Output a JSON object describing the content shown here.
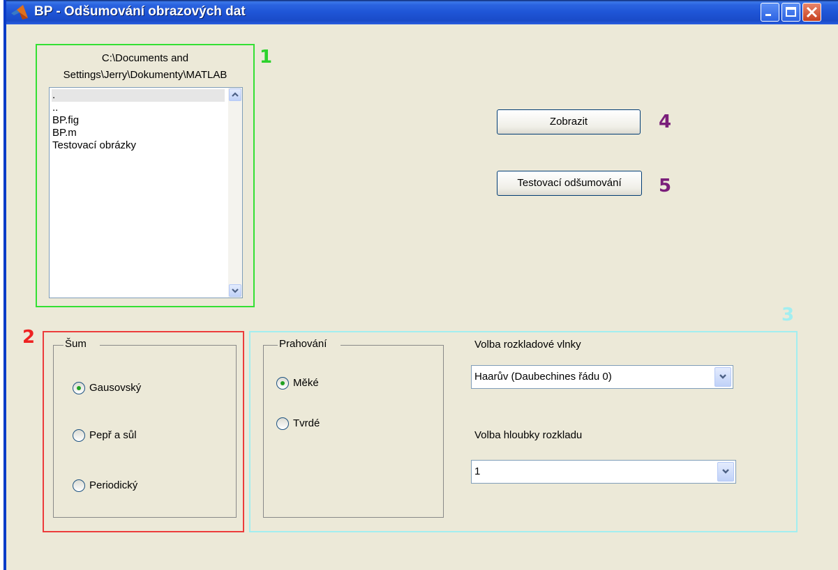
{
  "window": {
    "title": "BP - Odšumování obrazových dat",
    "titlebar_color": "#2b64e0",
    "background": "#ece9d8",
    "controls": [
      "minimize-icon",
      "maximize-icon",
      "close-icon"
    ]
  },
  "annotations": {
    "n1": "1",
    "n2": "2",
    "n3": "3",
    "n4": "4",
    "n5": "5",
    "colors": {
      "n1": "#2cd22c",
      "n2": "#ee2222",
      "n3": "#a2eef0",
      "n4": "#7a1e7a",
      "n5": "#7a1e7a"
    }
  },
  "file_browser": {
    "path_line1": "C:\\Documents and",
    "path_line2": "Settings\\Jerry\\Dokumenty\\MATLAB",
    "items": [
      ".",
      "..",
      "BP.fig",
      "BP.m",
      "Testovací obrázky"
    ],
    "selected_index": 0
  },
  "buttons": {
    "zobrazit": "Zobrazit",
    "testovaci": "Testovací odšumování"
  },
  "noise_group": {
    "title": "Šum",
    "options": [
      "Gausovský",
      "Pepř a sůl",
      "Periodický"
    ],
    "selected": "Gausovský"
  },
  "threshold_group": {
    "title": "Prahování",
    "options": [
      "Měké",
      "Tvrdé"
    ],
    "selected": "Měké"
  },
  "wavelet": {
    "label": "Volba rozkladové vlnky",
    "value": "Haarův (Daubechines řádu 0)"
  },
  "depth": {
    "label": "Volba hloubky rozkladu",
    "value": "1"
  }
}
